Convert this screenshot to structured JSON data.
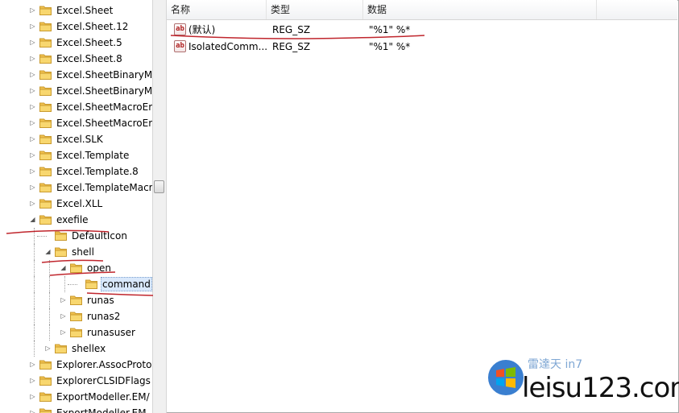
{
  "tree": {
    "items": [
      {
        "label": "Excel.Sheet",
        "level": 0,
        "expander": "collapsed"
      },
      {
        "label": "Excel.Sheet.12",
        "level": 0,
        "expander": "collapsed"
      },
      {
        "label": "Excel.Sheet.5",
        "level": 0,
        "expander": "collapsed"
      },
      {
        "label": "Excel.Sheet.8",
        "level": 0,
        "expander": "collapsed"
      },
      {
        "label": "Excel.SheetBinaryMa",
        "level": 0,
        "expander": "collapsed"
      },
      {
        "label": "Excel.SheetBinaryMa",
        "level": 0,
        "expander": "collapsed"
      },
      {
        "label": "Excel.SheetMacroEr",
        "level": 0,
        "expander": "collapsed"
      },
      {
        "label": "Excel.SheetMacroEr",
        "level": 0,
        "expander": "collapsed"
      },
      {
        "label": "Excel.SLK",
        "level": 0,
        "expander": "collapsed"
      },
      {
        "label": "Excel.Template",
        "level": 0,
        "expander": "collapsed"
      },
      {
        "label": "Excel.Template.8",
        "level": 0,
        "expander": "collapsed"
      },
      {
        "label": "Excel.TemplateMacr",
        "level": 0,
        "expander": "collapsed"
      },
      {
        "label": "Excel.XLL",
        "level": 0,
        "expander": "collapsed"
      },
      {
        "label": "exefile",
        "level": 0,
        "expander": "expanded"
      },
      {
        "label": "DefaultIcon",
        "level": 1,
        "expander": "none"
      },
      {
        "label": "shell",
        "level": 1,
        "expander": "expanded"
      },
      {
        "label": "open",
        "level": 2,
        "expander": "expanded"
      },
      {
        "label": "command",
        "level": 3,
        "expander": "none",
        "selected": true
      },
      {
        "label": "runas",
        "level": 2,
        "expander": "collapsed"
      },
      {
        "label": "runas2",
        "level": 2,
        "expander": "collapsed"
      },
      {
        "label": "runasuser",
        "level": 2,
        "expander": "collapsed"
      },
      {
        "label": "shellex",
        "level": 1,
        "expander": "collapsed"
      },
      {
        "label": "Explorer.AssocProto",
        "level": 0,
        "expander": "collapsed"
      },
      {
        "label": "ExplorerCLSIDFlags",
        "level": 0,
        "expander": "collapsed"
      },
      {
        "label": "ExportModeller.EM/",
        "level": 0,
        "expander": "collapsed"
      },
      {
        "label": "ExportModeller.EM",
        "level": 0,
        "expander": "collapsed"
      }
    ]
  },
  "list": {
    "columns": {
      "name": "名称",
      "type": "类型",
      "data": "数据"
    },
    "rows": [
      {
        "name": "(默认)",
        "type": "REG_SZ",
        "data": "\"%1\" %*",
        "icon": "string-value-icon"
      },
      {
        "name": "IsolatedComm...",
        "type": "REG_SZ",
        "data": "\"%1\" %*",
        "icon": "string-value-icon"
      }
    ]
  },
  "watermark": {
    "text": "leisu123.com",
    "small": "雷達天 in7"
  },
  "colors": {
    "annotation": "#c0262d",
    "selection": "#d9e8fb",
    "folder": "#f2c24f"
  }
}
